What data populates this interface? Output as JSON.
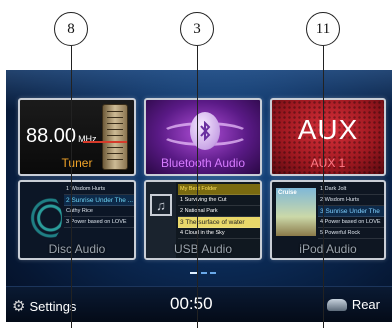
{
  "callouts": [
    "8",
    "3",
    "11"
  ],
  "tiles": {
    "tuner": {
      "frequency": "88.00",
      "unit": "MHz",
      "label": "Tuner"
    },
    "bluetooth": {
      "label": "Bluetooth Audio",
      "icon": "bluetooth-icon"
    },
    "aux": {
      "big": "AUX",
      "label": "AUX 1"
    },
    "disc": {
      "label": "Disc Audio",
      "tracks": [
        {
          "n": "1",
          "title": "Wisdom Hurts"
        },
        {
          "n": "2",
          "title": "Sunrise Under The ..."
        },
        {
          "n": "",
          "title": "Cathy Rice"
        },
        {
          "n": "3",
          "title": "Power based on LOVE"
        }
      ]
    },
    "usb": {
      "label": "USB Audio",
      "icon": "music-note-icon",
      "tracks": [
        {
          "n": "",
          "title": "My Best Folder"
        },
        {
          "n": "1",
          "title": "Surviving the Cut"
        },
        {
          "n": "2",
          "title": "National Park"
        },
        {
          "n": "3",
          "title": "The surface of water"
        },
        {
          "n": "4",
          "title": "Cloud in the Sky"
        }
      ]
    },
    "ipod": {
      "label": "iPod Audio",
      "cover_title": "Cruise",
      "tracks": [
        {
          "n": "1",
          "title": "Dark Jolt"
        },
        {
          "n": "2",
          "title": "Wisdom Hurts"
        },
        {
          "n": "3",
          "title": "Sunrise Under The"
        },
        {
          "n": "4",
          "title": "Power based on LOVE"
        },
        {
          "n": "5",
          "title": "Powerful Rock"
        }
      ]
    }
  },
  "bottom": {
    "settings_label": "Settings",
    "clock": "00:50",
    "rear_label": "Rear"
  },
  "colors": {
    "tuner_label": "#f0a328",
    "bluetooth_label": "#d77bff",
    "aux_label": "#ff7b86"
  }
}
